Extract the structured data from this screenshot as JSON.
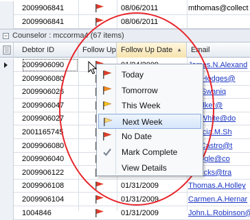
{
  "top_rows": [
    {
      "id": "2009906841",
      "date": "08/06/2011",
      "email": "mthomas@collect",
      "email_style": "plain",
      "flag": "red"
    },
    {
      "id": "2009906841",
      "date": "08/06/2011",
      "email": "",
      "email_style": "plain",
      "flag": "red"
    }
  ],
  "group": {
    "label": "Counselor : mccorma4  (67 items)",
    "toggle": "−"
  },
  "columns": {
    "debtor_id": "Debtor ID",
    "follow_up": "Follow Up",
    "follow_up_date": "Follow Up Date",
    "email": "Email"
  },
  "rows": [
    {
      "id": "2009906090",
      "date": "01/24/2009",
      "email": "James.N.Alexand",
      "flag": "red",
      "current": true
    },
    {
      "id": "2009906080",
      "date": "",
      "email": "a.B.Hodges@",
      "flag": "red"
    },
    {
      "id": "2009906026",
      "date": "",
      "email": "s.S.Swaniq",
      "flag": "red"
    },
    {
      "id": "2009906047",
      "date": "",
      "email": "J.Volker@",
      "flag": "red"
    },
    {
      "id": "2009906027",
      "date": "",
      "email": "L.J.White@do",
      "flag": "red"
    },
    {
      "id": "2001165745",
      "date": "",
      "email": "idencia.M.Sh",
      "flag": "red"
    },
    {
      "id": "2009906080",
      "date": "",
      "email": "a.J.Castro@t",
      "flag": "red"
    },
    {
      "id": "2009906040",
      "date": "",
      "email": "E.Fogle@co",
      "flag": "red"
    },
    {
      "id": "2009906122",
      "date": "",
      "email": "M.Hicks@tra",
      "flag": "red"
    },
    {
      "id": "2009906108",
      "date": "01/31/2009",
      "email": "Thomas.A.Holley",
      "flag": "red"
    },
    {
      "id": "2009906104",
      "date": "01/31/2009",
      "email": "Carmen.A.Hernar",
      "flag": "red"
    },
    {
      "id": "1004846",
      "date": "01/31/2009",
      "email": "John.L.Robinson@",
      "flag": "red"
    }
  ],
  "context_menu": {
    "items": [
      {
        "label": "Today",
        "icon": "red-flag-icon",
        "color": "#e03a2a"
      },
      {
        "label": "Tomorrow",
        "icon": "orange-flag-icon",
        "color": "#f08a1c"
      },
      {
        "label": "This Week",
        "icon": "yellow-flag-icon",
        "color": "#f2c21b"
      },
      {
        "label": "Next Week",
        "icon": "light-flag-icon",
        "color": "#f4d870",
        "highlighted": true
      },
      {
        "label": "No Date",
        "icon": "red-flag-icon",
        "color": "#e03a2a"
      },
      {
        "label": "Mark Complete",
        "icon": "checkmark-icon",
        "color": "#7a8492"
      },
      {
        "label": "View Details",
        "icon": "",
        "color": ""
      }
    ]
  },
  "colors": {
    "flag_red": "#e03a2a",
    "link": "#1a35c4",
    "highlight_circle": "#e8242a"
  }
}
